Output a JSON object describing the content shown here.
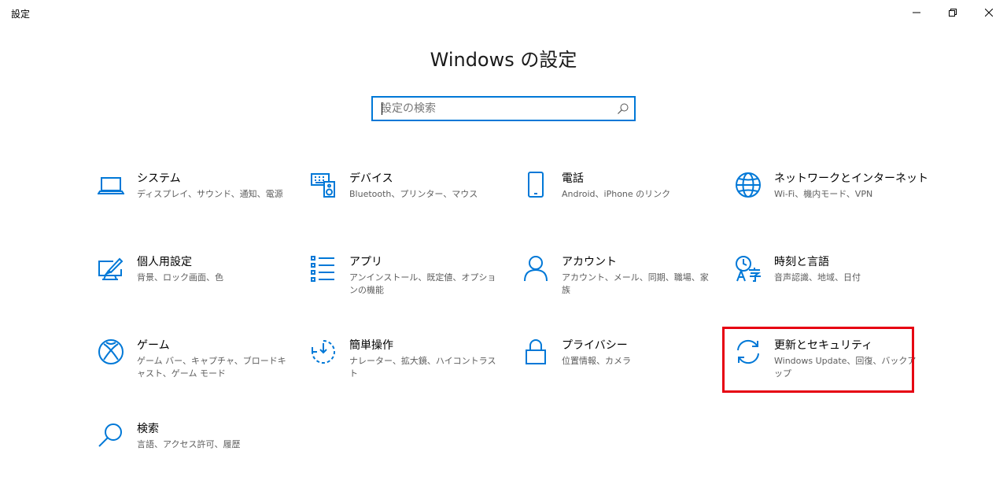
{
  "window": {
    "title": "設定",
    "minimize_icon": "minimize-icon",
    "maximize_icon": "restore-icon",
    "close_icon": "close-icon"
  },
  "header": {
    "title": "Windows の設定"
  },
  "search": {
    "placeholder": "設定の検索",
    "value": "",
    "icon": "search-icon"
  },
  "accent_color": "#0078d7",
  "highlight_color": "#e60012",
  "tiles": [
    {
      "title": "システム",
      "desc": "ディスプレイ、サウンド、通知、電源",
      "icon": "laptop-icon"
    },
    {
      "title": "デバイス",
      "desc": "Bluetooth、プリンター、マウス",
      "icon": "keyboard-speaker-icon"
    },
    {
      "title": "電話",
      "desc": "Android、iPhone のリンク",
      "icon": "phone-icon"
    },
    {
      "title": "ネットワークとインターネット",
      "desc": "Wi-Fi、機内モード、VPN",
      "icon": "globe-icon"
    },
    {
      "title": "個人用設定",
      "desc": "背景、ロック画面、色",
      "icon": "paint-icon"
    },
    {
      "title": "アプリ",
      "desc": "アンインストール、既定値、オプションの機能",
      "icon": "apps-list-icon"
    },
    {
      "title": "アカウント",
      "desc": "アカウント、メール、同期、職場、家族",
      "icon": "person-icon"
    },
    {
      "title": "時刻と言語",
      "desc": "音声認識、地域、日付",
      "icon": "time-language-icon"
    },
    {
      "title": "ゲーム",
      "desc": "ゲーム バー、キャプチャ、ブロードキャスト、ゲーム モード",
      "icon": "xbox-icon"
    },
    {
      "title": "簡単操作",
      "desc": "ナレーター、拡大鏡、ハイコントラスト",
      "icon": "ease-of-access-icon"
    },
    {
      "title": "プライバシー",
      "desc": "位置情報、カメラ",
      "icon": "lock-icon"
    },
    {
      "title": "更新とセキュリティ",
      "desc": "Windows Update、回復、バックアップ",
      "icon": "sync-icon"
    },
    {
      "title": "検索",
      "desc": "言語、アクセス許可、履歴",
      "icon": "magnifier-icon"
    }
  ]
}
